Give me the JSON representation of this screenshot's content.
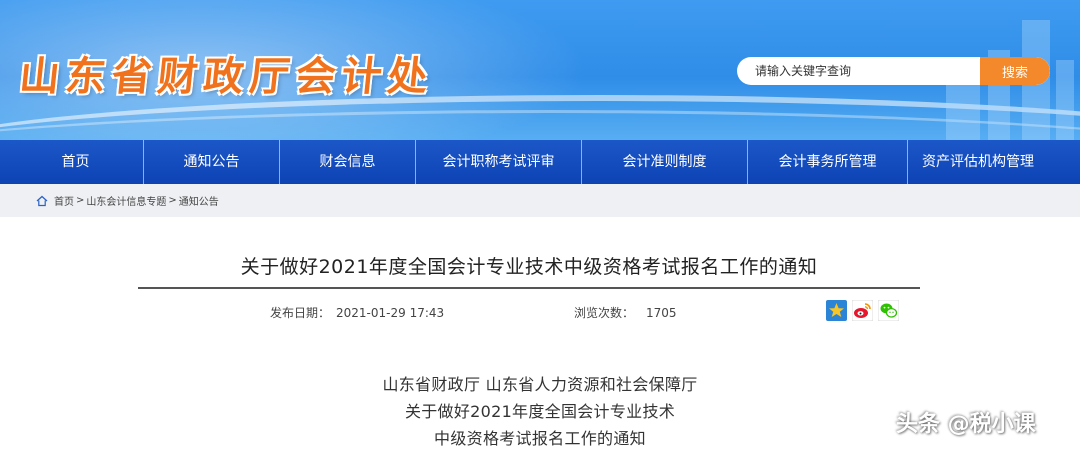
{
  "header": {
    "site_title": "山东省财政厅会计处",
    "search": {
      "placeholder": "请输入关键字查询",
      "button_label": "搜索"
    }
  },
  "nav": {
    "items": [
      {
        "label": "首页"
      },
      {
        "label": "通知公告"
      },
      {
        "label": "财会信息"
      },
      {
        "label": "会计职称考试评审"
      },
      {
        "label": "会计准则制度"
      },
      {
        "label": "会计事务所管理"
      },
      {
        "label": "资产评估机构管理"
      }
    ]
  },
  "breadcrumb": {
    "items": [
      "首页",
      "山东会计信息专题",
      "通知公告"
    ],
    "separator": ">"
  },
  "article": {
    "title": "关于做好2021年度全国会计专业技术中级资格考试报名工作的通知",
    "publish_label": "发布日期：",
    "publish_date": "2021-01-29 17:43",
    "views_label": "浏览次数：",
    "views": "1705",
    "share_icons": [
      "qzone-icon",
      "weibo-icon",
      "wechat-icon"
    ],
    "body_lines": [
      "山东省财政厅    山东省人力资源和社会保障厅",
      "关于做好2021年度全国会计专业技术",
      "中级资格考试报名工作的通知"
    ]
  },
  "watermark": "头条 @税小课",
  "colors": {
    "banner_blue": "#2f8de8",
    "nav_blue": "#0d43b4",
    "accent_orange": "#f3892a",
    "title_orange": "#f0721c"
  }
}
